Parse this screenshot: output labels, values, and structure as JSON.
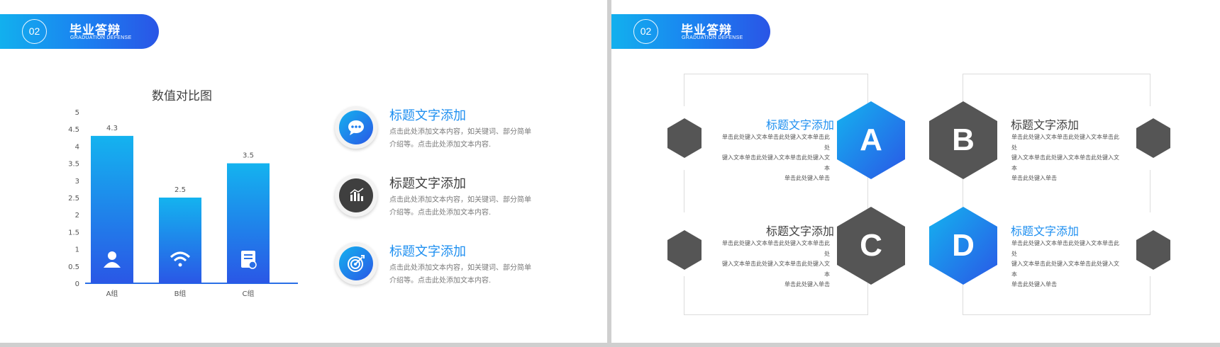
{
  "left_slide": {
    "header": {
      "number": "02",
      "title": "毕业答辩",
      "subtitle": "GRADUATION    DEFENSE"
    },
    "chart_title": "数值对比图",
    "items": [
      {
        "title": "标题文字添加",
        "desc_line1": "点击此处添加文本内容，如关键词、部分简单",
        "desc_line2": "介绍等。点击此处添加文本内容.",
        "icon": "chat-bubble-icon",
        "style": "blue"
      },
      {
        "title": "标题文字添加",
        "desc_line1": "点击此处添加文本内容，如关键词、部分简单",
        "desc_line2": "介绍等。点击此处添加文本内容.",
        "icon": "bar-chart-icon",
        "style": "dark"
      },
      {
        "title": "标题文字添加",
        "desc_line1": "点击此处添加文本内容，如关键词、部分简单",
        "desc_line2": "介绍等。点击此处添加文本内容.",
        "icon": "target-icon",
        "style": "blue"
      }
    ]
  },
  "chart_data": {
    "type": "bar",
    "title": "数值对比图",
    "categories": [
      "A组",
      "B组",
      "C组"
    ],
    "values": [
      4.3,
      2.5,
      3.5
    ],
    "data_labels": [
      "4.3",
      "2.5",
      "3.5"
    ],
    "ylim": [
      0,
      5
    ],
    "yticks": [
      "0",
      "0.5",
      "1",
      "1.5",
      "2",
      "2.5",
      "3",
      "3.5",
      "4",
      "4.5",
      "5"
    ],
    "bar_icons": [
      "user-icon",
      "wifi-icon",
      "document-icon"
    ],
    "grid": false,
    "colors": {
      "bar_top": "#14b3ef",
      "bar_bottom": "#2a57e6",
      "axis": "#2a6fe6"
    }
  },
  "right_slide": {
    "header": {
      "number": "02",
      "title": "毕业答辩",
      "subtitle": "GRADUATION    DEFENSE"
    },
    "blocks": [
      {
        "letter": "A",
        "title": "标题文字添加",
        "desc": [
          "单击此处键入文本单击此处键入文本单击此处",
          "键入文本单击此处键入文本单击此处键入文本",
          "单击此处键入单击"
        ],
        "style": "blue"
      },
      {
        "letter": "B",
        "title": "标题文字添加",
        "desc": [
          "单击此处键入文本单击此处键入文本单击此处",
          "键入文本单击此处键入文本单击此处键入文本",
          "单击此处键入单击"
        ],
        "style": "dark"
      },
      {
        "letter": "C",
        "title": "标题文字添加",
        "desc": [
          "单击此处键入文本单击此处键入文本单击此处",
          "键入文本单击此处键入文本单击此处键入文本",
          "单击此处键入单击"
        ],
        "style": "dark"
      },
      {
        "letter": "D",
        "title": "标题文字添加",
        "desc": [
          "单击此处键入文本单击此处键入文本单击此处",
          "键入文本单击此处键入文本单击此处键入文本",
          "单击此处键入单击"
        ],
        "style": "blue"
      }
    ]
  },
  "colors": {
    "brand_blue": "#1e8ff0",
    "dark_gray": "#404040",
    "hex_gray": "#555555"
  }
}
